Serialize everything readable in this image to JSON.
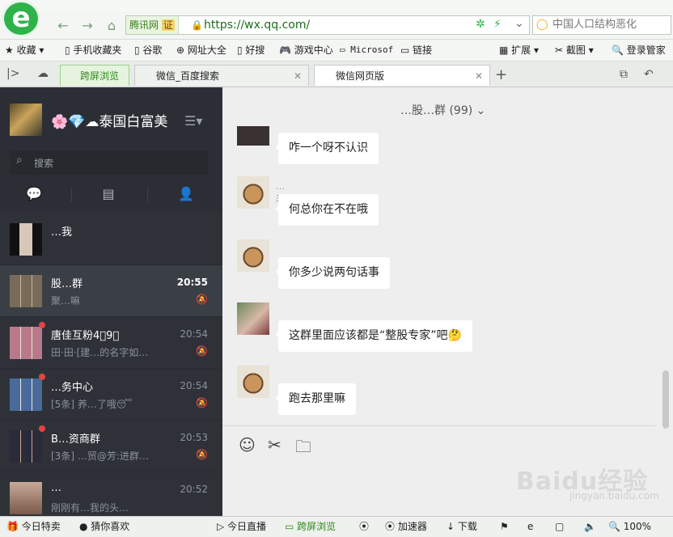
{
  "browser": {
    "url": "https://wx.qq.com/",
    "site_label": "腾讯网",
    "cert_label": "证",
    "search_text": "中国人口结构恶化",
    "bookmarks": [
      "收藏",
      "手机收藏夹",
      "谷歌",
      "网址大全",
      "好搜",
      "游戏中心",
      "Microsof",
      "链接",
      "扩展",
      "截图",
      "登录管家"
    ],
    "tabs": [
      {
        "label": "跨屏浏览"
      },
      {
        "label": "微信_百度搜索"
      },
      {
        "label": "微信网页版"
      }
    ]
  },
  "wechat": {
    "my_name": "🌸💎☁泰国白富美",
    "search_placeholder": "搜索",
    "chats": [
      {
        "name": "…我",
        "preview": "",
        "time": ""
      },
      {
        "name": "股…群",
        "preview": "聚…嘛",
        "time": "20:55"
      },
      {
        "name": "唐佳互粉4⃣9⃣",
        "preview": "田·田·[建…的名字如…",
        "time": "20:54"
      },
      {
        "name": "…务中心",
        "preview": "[5条] 养…了哦😴",
        "time": "20:54"
      },
      {
        "name": "B…资商群",
        "preview": "[3条] …贸@芳:进群…",
        "time": "20:53"
      },
      {
        "name": "…",
        "preview": "刚刚有…我的头…",
        "time": "20:52"
      }
    ],
    "conversation_title": "…股…群 (99)",
    "messages": [
      {
        "sender": "",
        "text": "咋一个呀不认识"
      },
      {
        "sender": "…来",
        "text": "何总你在不在哦"
      },
      {
        "sender": "",
        "text": "你多少说两句话事"
      },
      {
        "sender": "",
        "text": "这群里面应该都是“整股专家”吧🤔"
      },
      {
        "sender": "",
        "text": "跑去那里嘛"
      }
    ]
  },
  "statusbar": {
    "items": [
      "今日特卖",
      "猜你喜欢",
      "今日直播",
      "跨屏浏览",
      "加速器",
      "下载"
    ],
    "zoom": "100%"
  },
  "watermark": {
    "brand": "Baidu经验",
    "url": "jingyan.baidu.com"
  }
}
